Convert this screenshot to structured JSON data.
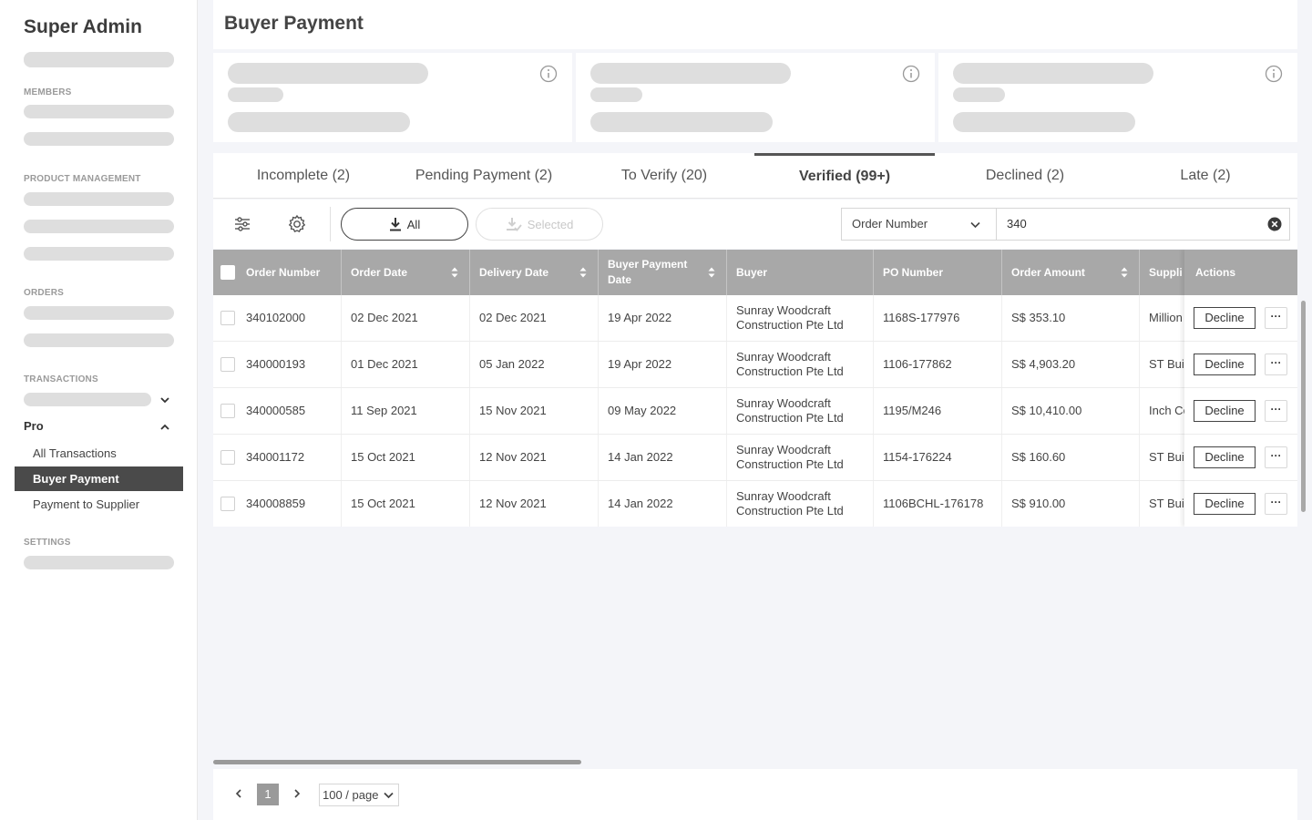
{
  "sidebar": {
    "brand": "Super Admin",
    "sections": {
      "members": "MEMBERS",
      "product_management": "PRODUCT MANAGEMENT",
      "orders": "ORDERS",
      "transactions": "TRANSACTIONS",
      "settings": "SETTINGS"
    },
    "pro_label": "Pro",
    "pro_items": [
      {
        "label": "All Transactions",
        "active": false
      },
      {
        "label": "Buyer Payment",
        "active": true
      },
      {
        "label": "Payment to Supplier",
        "active": false
      }
    ]
  },
  "header": {
    "title": "Buyer Payment"
  },
  "tabs": [
    {
      "label": "Incomplete (2)",
      "active": false
    },
    {
      "label": "Pending Payment (2)",
      "active": false
    },
    {
      "label": "To Verify (20)",
      "active": false
    },
    {
      "label": "Verified (99+)",
      "active": true
    },
    {
      "label": "Declined (2)",
      "active": false
    },
    {
      "label": "Late (2)",
      "active": false
    }
  ],
  "toolbar": {
    "download_all_label": "All",
    "download_selected_label": "Selected",
    "filter_field": "Order Number",
    "search_value": "340"
  },
  "table": {
    "columns": [
      "Order Number",
      "Order Date",
      "Delivery Date",
      "Buyer Payment Date",
      "Buyer",
      "PO Number",
      "Order Amount",
      "Suppli",
      "Actions"
    ],
    "rows": [
      {
        "order_number": "340102000",
        "order_date": "02 Dec 2021",
        "delivery_date": "02 Dec 2021",
        "payment_date": "19 Apr 2022",
        "buyer": "Sunray Woodcraft Construction Pte Ltd",
        "po_number": "1168S-177976",
        "amount": "S$ 353.10",
        "supplier": "Million"
      },
      {
        "order_number": "340000193",
        "order_date": "01 Dec 2021",
        "delivery_date": "05 Jan 2022",
        "payment_date": "19 Apr 2022",
        "buyer": "Sunray Woodcraft Construction Pte Ltd",
        "po_number": "1106-177862",
        "amount": "S$ 4,903.20",
        "supplier": "ST Build"
      },
      {
        "order_number": "340000585",
        "order_date": "11 Sep 2021",
        "delivery_date": "15 Nov 2021",
        "payment_date": "09 May 2022",
        "buyer": "Sunray Woodcraft Construction Pte Ltd",
        "po_number": "1195/M246",
        "amount": "S$ 10,410.00",
        "supplier": "Inch Co"
      },
      {
        "order_number": "340001172",
        "order_date": "15 Oct 2021",
        "delivery_date": "12 Nov 2021",
        "payment_date": "14 Jan 2022",
        "buyer": "Sunray Woodcraft Construction Pte Ltd",
        "po_number": "1154-176224",
        "amount": "S$ 160.60",
        "supplier": "ST Build"
      },
      {
        "order_number": "340008859",
        "order_date": "15 Oct 2021",
        "delivery_date": "12 Nov 2021",
        "payment_date": "14 Jan 2022",
        "buyer": "Sunray Woodcraft Construction Pte Ltd",
        "po_number": "1106BCHL-176178",
        "amount": "S$ 910.00",
        "supplier": "ST Build"
      }
    ],
    "decline_label": "Decline",
    "more_label": "···"
  },
  "pagination": {
    "current_page": "1",
    "page_size": "100 / page"
  },
  "colors": {
    "active_nav": "#4a4a4a",
    "table_header": "#a8a8a8",
    "skeleton": "#dedede"
  }
}
